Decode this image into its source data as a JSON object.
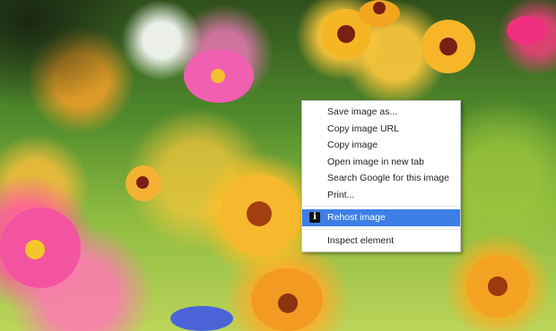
{
  "context_menu": {
    "items": [
      {
        "label": "Save image as..."
      },
      {
        "label": "Copy image URL"
      },
      {
        "label": "Copy image"
      },
      {
        "label": "Open image in new tab"
      },
      {
        "label": "Search Google for this image"
      },
      {
        "label": "Print..."
      },
      {
        "label": "Rehost image",
        "icon": "info-icon",
        "icon_glyph": "i",
        "highlighted": true
      },
      {
        "label": "Inspect element"
      }
    ],
    "highlight_color": "#3d7fe6"
  }
}
